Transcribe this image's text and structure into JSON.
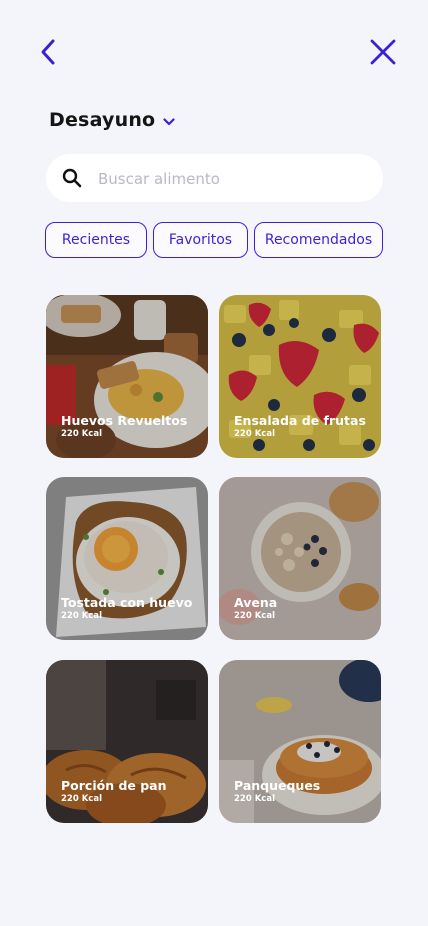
{
  "header": {
    "back_icon": "chevron-left-icon",
    "close_icon": "close-icon"
  },
  "meal": {
    "title": "Desayuno",
    "chevron_icon": "chevron-down-icon"
  },
  "search": {
    "placeholder": "Buscar alimento",
    "value": "",
    "icon": "search-icon"
  },
  "filters": [
    {
      "label": "Recientes"
    },
    {
      "label": "Favoritos"
    },
    {
      "label": "Recomendados"
    }
  ],
  "foods": [
    {
      "name": "Huevos Revueltos",
      "kcal": "220 Kcal"
    },
    {
      "name": "Ensalada de frutas",
      "kcal": "220 Kcal"
    },
    {
      "name": "Tostada con huevo",
      "kcal": "220 Kcal"
    },
    {
      "name": "Avena",
      "kcal": "220 Kcal"
    },
    {
      "name": "Porción de pan",
      "kcal": "220 Kcal"
    },
    {
      "name": "Panqueques",
      "kcal": "220 Kcal"
    }
  ],
  "colors": {
    "accent": "#3f1fd6",
    "background": "#f4f5fa",
    "search_bg": "#ffffff"
  }
}
